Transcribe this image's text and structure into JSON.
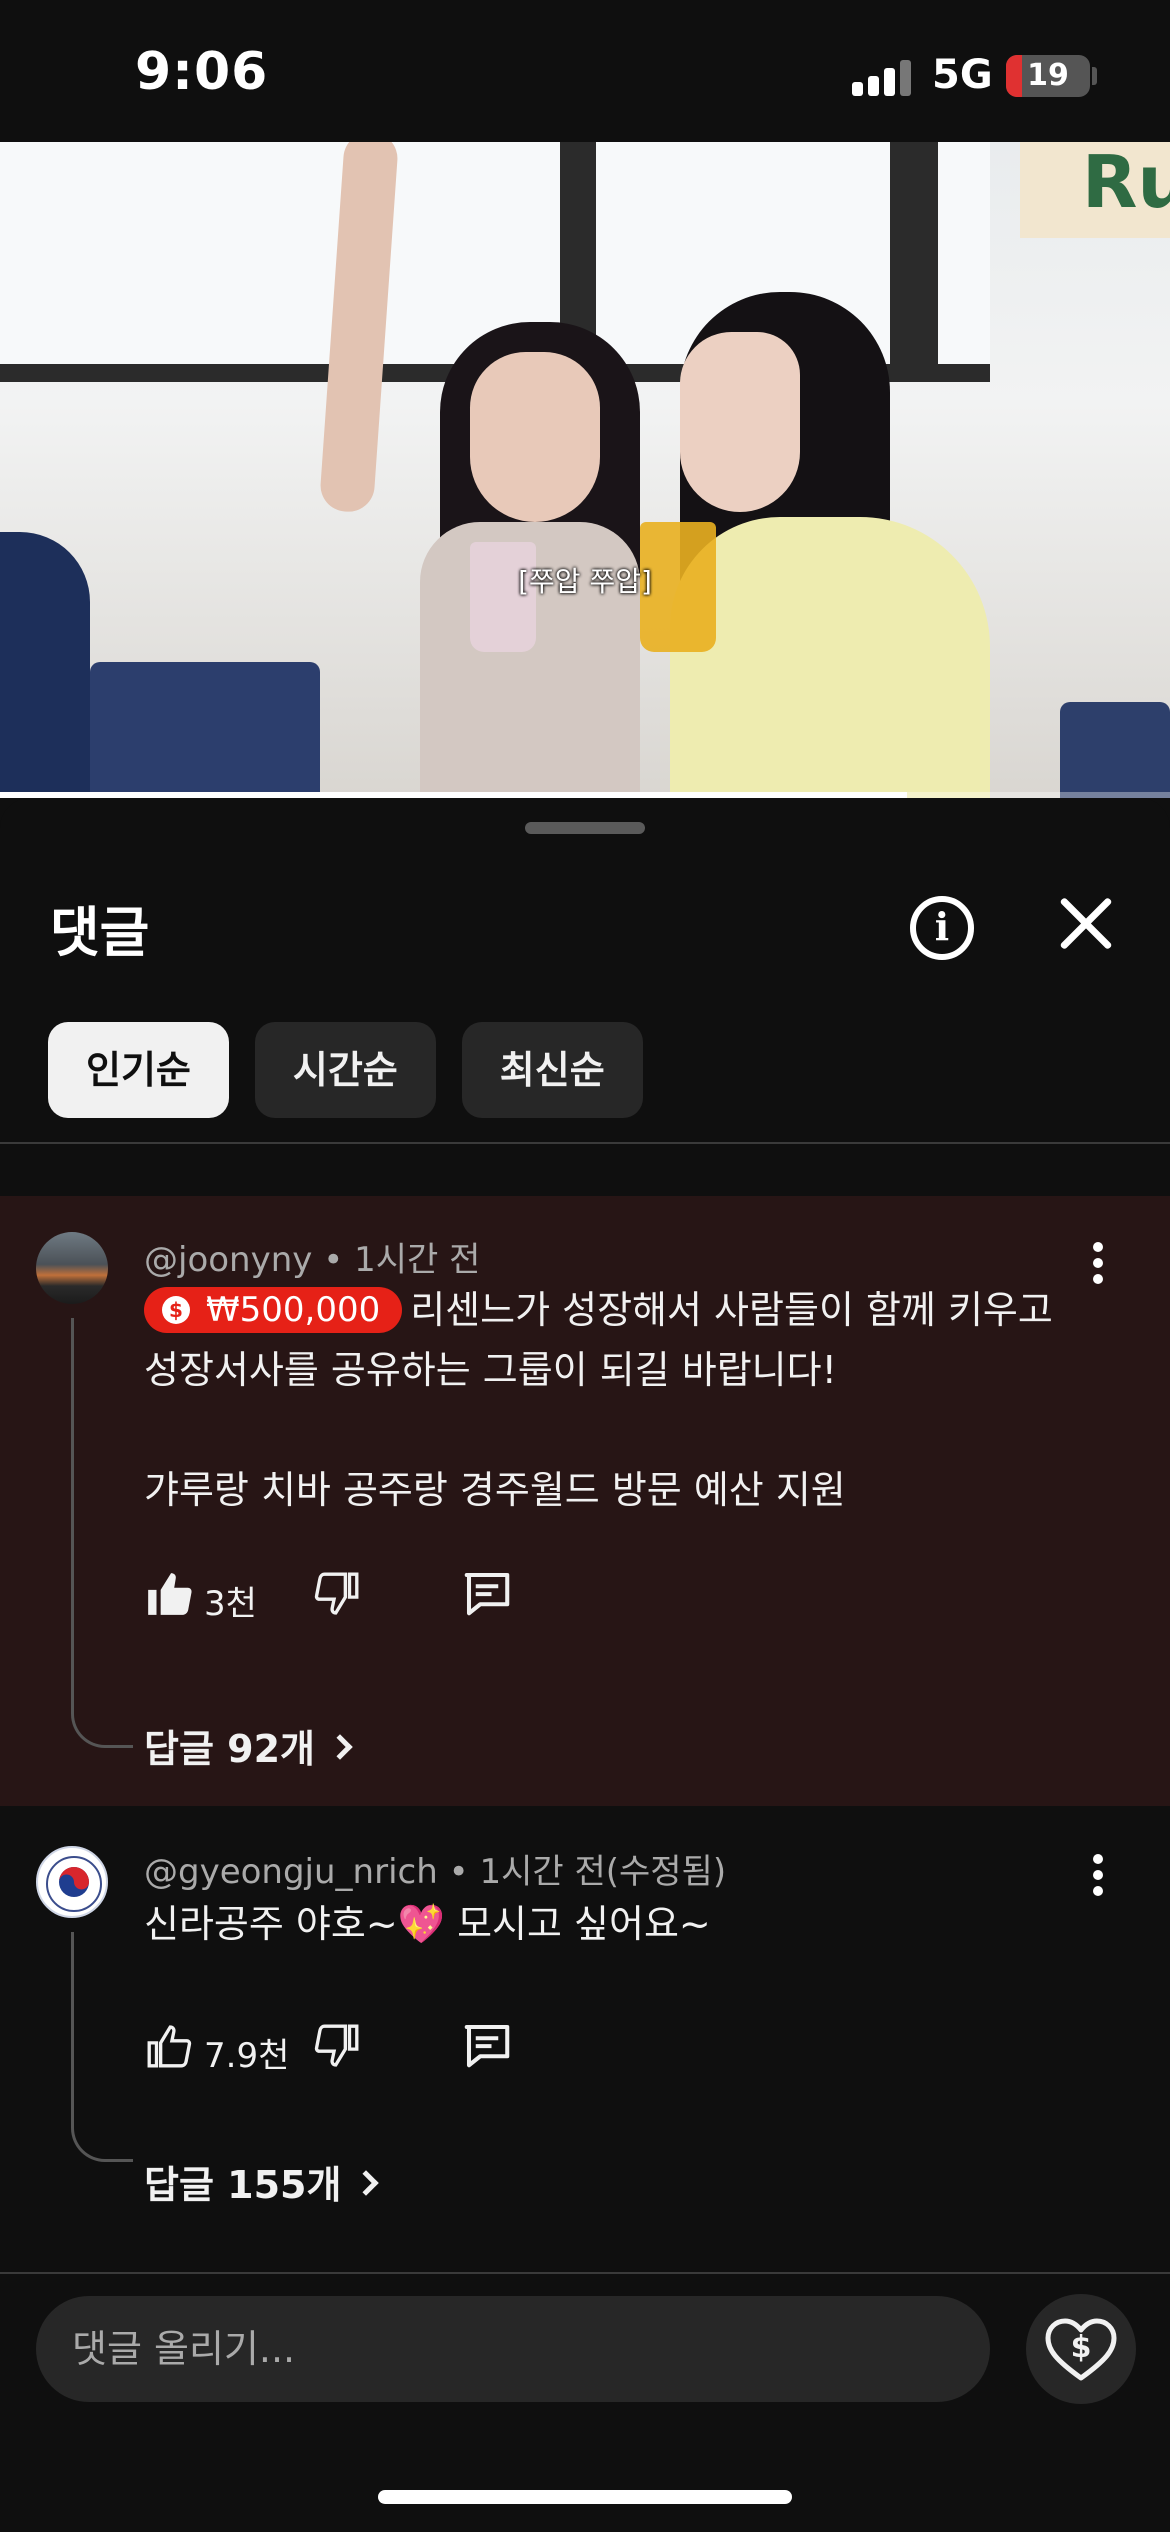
{
  "status_bar": {
    "time": "9:06",
    "network": "5G",
    "battery": "19",
    "battery_level": 0.19
  },
  "video": {
    "subtitle": "[쭈압 쭈압]",
    "sign_text": "Ru",
    "progress": 0.775
  },
  "sheet": {
    "title": "댓글",
    "info_icon": "info-icon",
    "close_icon": "close-icon",
    "sort_chips": [
      {
        "label": "인기순",
        "active": true
      },
      {
        "label": "시간순",
        "active": false
      },
      {
        "label": "최신순",
        "active": false
      }
    ]
  },
  "comments": [
    {
      "author": "@joonyny",
      "time": "1시간 전",
      "donation": "₩500,000",
      "text_line1": "리센느가 성장해서 사람들이 함께 키우고",
      "text_line2": "성장서사를 공유하는 그룹이 되길 바랍니다!",
      "text_line3": "갸루랑 치바 공주랑 경주월드 방문 예산 지원",
      "likes": "3천",
      "replies": "답글 92개",
      "highlight_color": "#271515"
    },
    {
      "author": "@gyeongju_nrich",
      "time": "1시간 전(수정됨)",
      "text": "신라공주 야호~💖 모시고 싶어요~",
      "likes": "7.9천",
      "replies": "답글 155개"
    }
  ],
  "composer": {
    "placeholder": "댓글 올리기..."
  },
  "colors": {
    "accent_red": "#e62117",
    "background": "#0f0f0f",
    "chip_bg": "#272727"
  }
}
